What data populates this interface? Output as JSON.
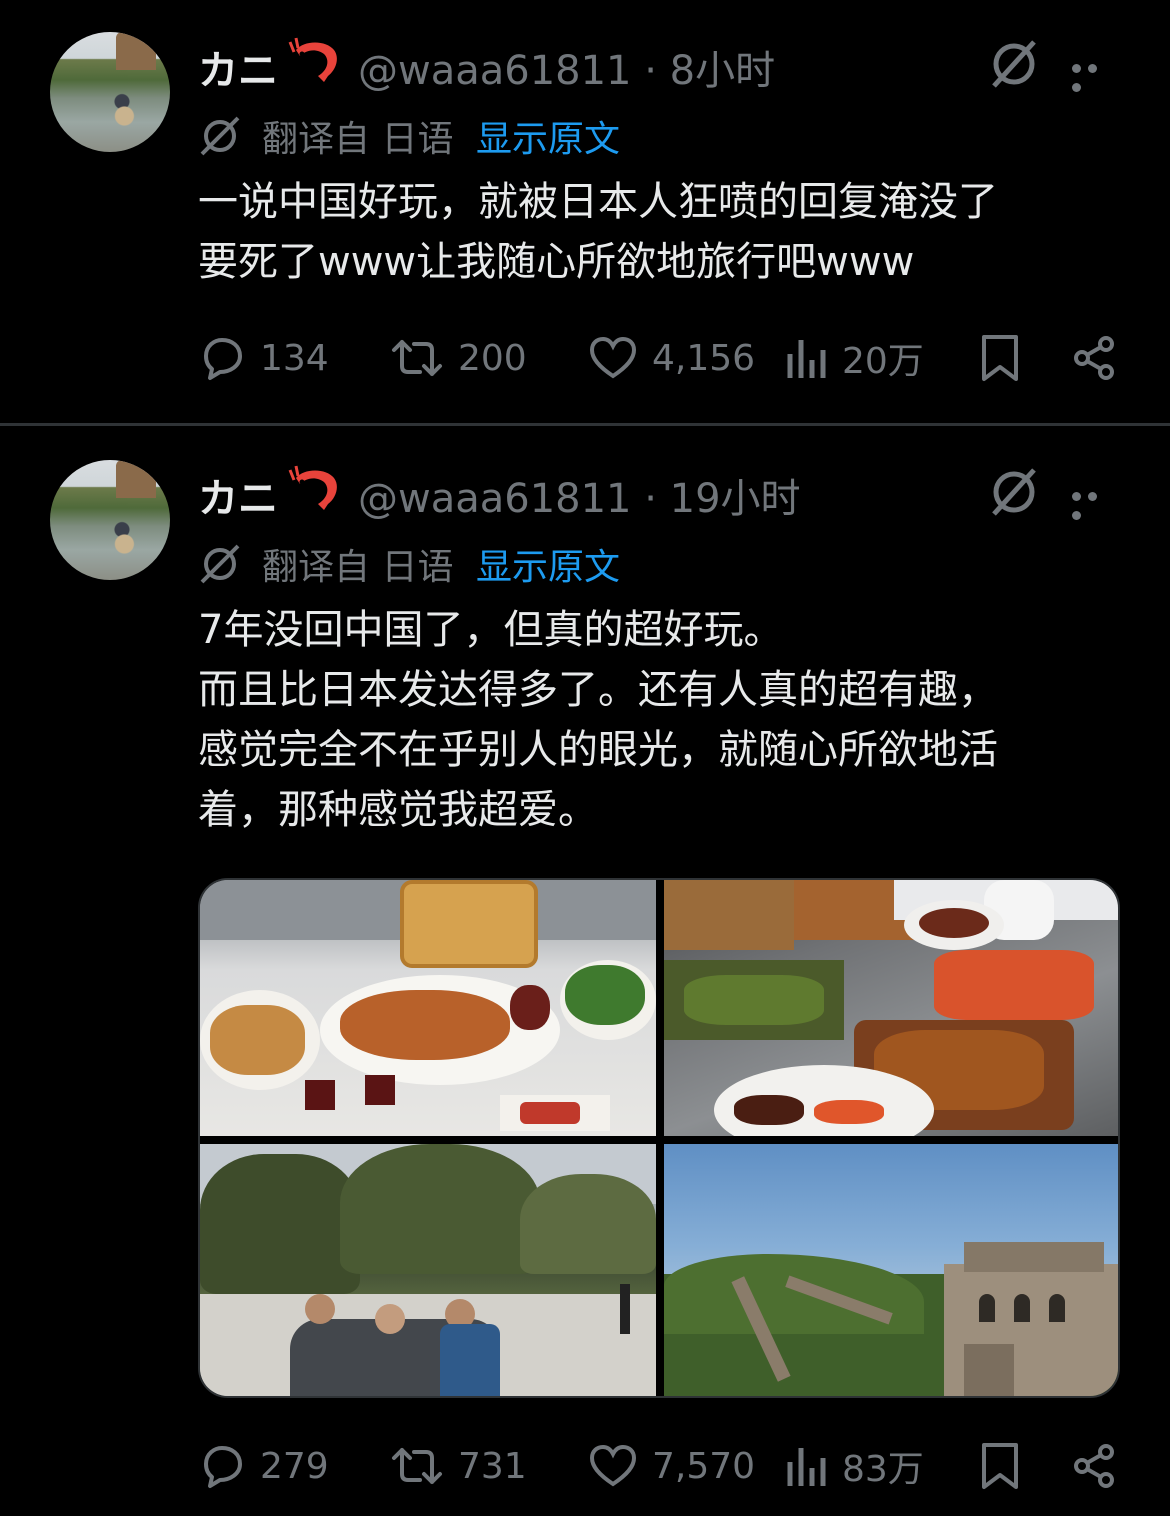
{
  "tweets": [
    {
      "author_name": "カニ",
      "author_emoji": "shrimp-emoji",
      "handle_time": "@waaa61811 · 8小时",
      "translated_from": "翻译自 日语",
      "show_original": "显示原文",
      "lines": [
        "一说中国好玩，就被日本人狂喷的回复淹没了",
        "要死了www让我随心所欲地旅行吧www"
      ],
      "stats": {
        "replies": "134",
        "reposts": "200",
        "likes": "4,156",
        "views": "20万"
      }
    },
    {
      "author_name": "カニ",
      "author_emoji": "shrimp-emoji",
      "handle_time": "@waaa61811 · 19小时",
      "translated_from": "翻译自 日语",
      "show_original": "显示原文",
      "lines": [
        "7年没回中国了，但真的超好玩。",
        "而且比日本发达得多了。还有人真的超有趣，",
        "感觉完全不在乎别人的眼光，就随心所欲地活",
        "着，那种感觉我超爱。"
      ],
      "media": [
        "roast-goose-meal-photo",
        "buffet-dishes-photo",
        "street-card-game-photo",
        "great-wall-photo"
      ],
      "stats": {
        "replies": "279",
        "reposts": "731",
        "likes": "7,570",
        "views": "83万"
      }
    }
  ],
  "colors": {
    "background": "#000000",
    "text": "#e7e9ea",
    "muted": "#71767b",
    "link": "#1d9bf0",
    "divider": "#2f3336"
  }
}
